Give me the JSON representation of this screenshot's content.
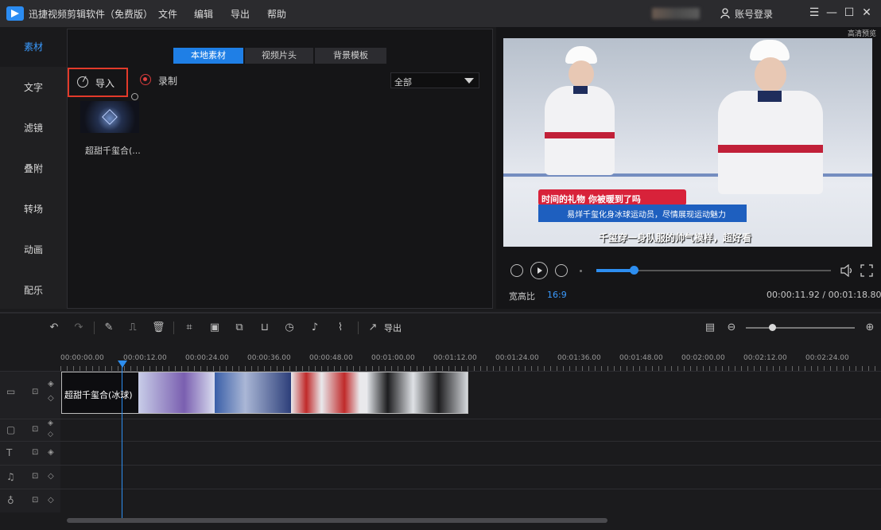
{
  "app": {
    "title": "迅捷视频剪辑软件（免费版）",
    "menus": [
      "文件",
      "编辑",
      "导出",
      "帮助"
    ],
    "login": "账号登录"
  },
  "nav": [
    "素材",
    "文字",
    "滤镜",
    "叠附",
    "转场",
    "动画",
    "配乐"
  ],
  "media": {
    "tabs": [
      "本地素材",
      "视频片头",
      "背景模板"
    ],
    "import_label": "导入",
    "record_label": "录制",
    "select_value": "全部",
    "item_name": "超甜千玺合(..."
  },
  "preview": {
    "tag": "高清预览",
    "banner1": "时间的礼物 你被暖到了吗",
    "banner2": "易烊千玺化身冰球运动员，尽情展现运动魅力",
    "caption": "千玺穿一身队服的帅气模样，超好看",
    "progress": 0.16,
    "aspect_label": "宽高比",
    "aspect_value": "16:9",
    "time": "00:00:11.92 / 00:01:18.80"
  },
  "toolbar": {
    "export_label": "导出"
  },
  "timeline": {
    "ruler": [
      "00:00:00.00",
      "00:00:12.00",
      "00:00:24.00",
      "00:00:36.00",
      "00:00:48.00",
      "00:01:00.00",
      "00:01:12.00",
      "00:01:24.00",
      "00:01:36.00",
      "00:01:48.00",
      "00:02:00.00",
      "00:02:12.00",
      "00:02:24.00"
    ],
    "clip_label": "超甜千玺合(冰球)",
    "zoom": 0.24
  }
}
